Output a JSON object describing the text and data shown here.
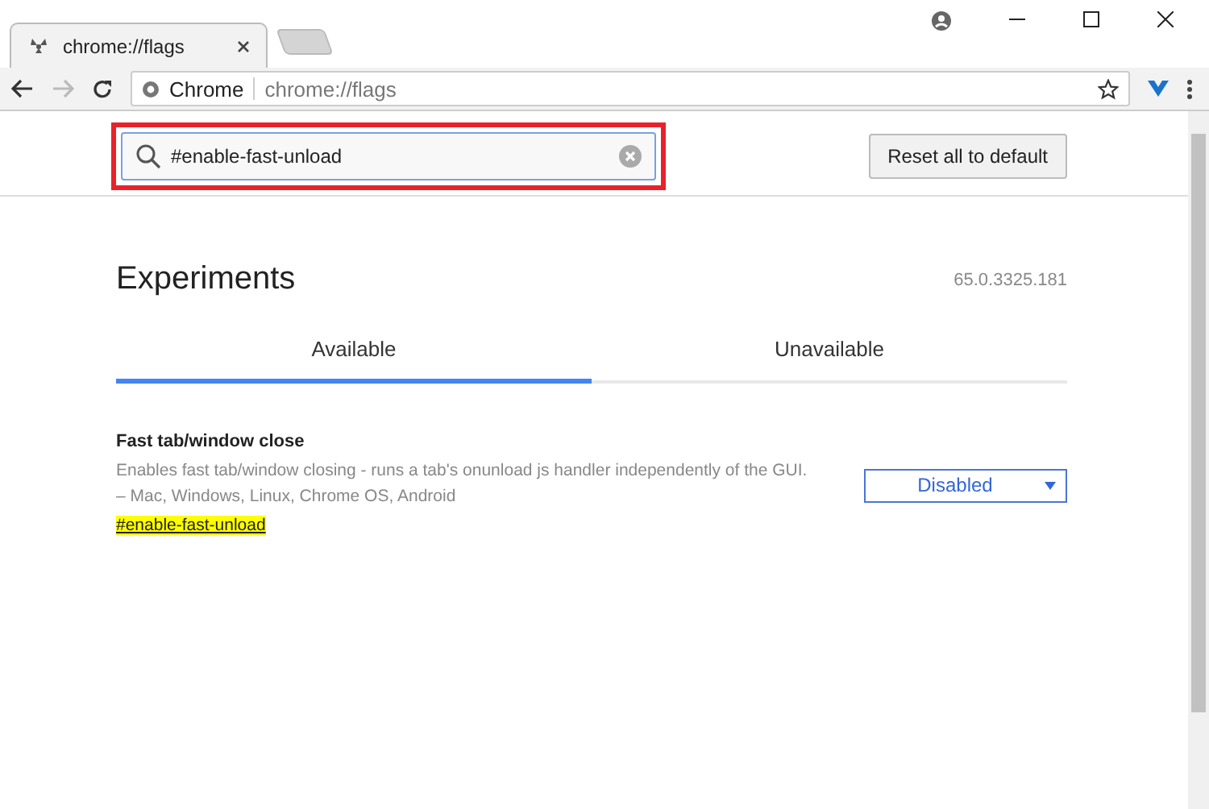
{
  "browser_tab": {
    "title": "chrome://flags"
  },
  "address_bar": {
    "site_label": "Chrome",
    "url": "chrome://flags"
  },
  "search": {
    "value": "#enable-fast-unload",
    "highlighted": true
  },
  "reset_button": "Reset all to default",
  "page": {
    "title": "Experiments",
    "version": "65.0.3325.181"
  },
  "tabs": [
    {
      "label": "Available",
      "selected": true
    },
    {
      "label": "Unavailable",
      "selected": false
    }
  ],
  "flags": [
    {
      "name": "Fast tab/window close",
      "description": "Enables fast tab/window closing - runs a tab's onunload js handler independently of the GUI.",
      "platforms": "– Mac, Windows, Linux, Chrome OS, Android",
      "anchor": "#enable-fast-unload",
      "anchor_highlighted": true,
      "setting": "Disabled"
    }
  ]
}
